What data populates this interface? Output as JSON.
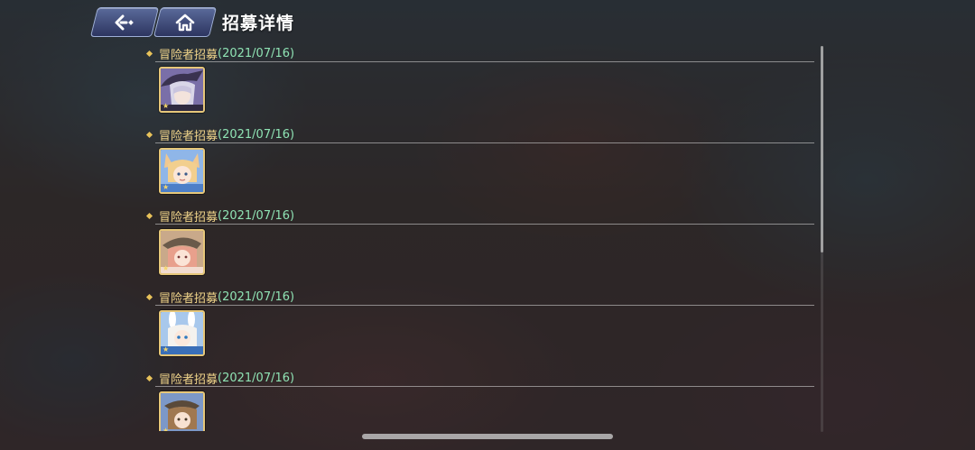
{
  "header": {
    "title": "招募详情",
    "back_icon": "back-arrow-icon",
    "home_icon": "home-icon"
  },
  "colors": {
    "entry_title": "#f0d48a",
    "entry_date": "#8fe3b4",
    "avatar_border": "#e6c77a"
  },
  "entries": [
    {
      "title": "冒险者招募",
      "date": "(2021/07/16)",
      "character": "silver-hair-witch-hat"
    },
    {
      "title": "冒险者招募",
      "date": "(2021/07/16)",
      "character": "blonde-fox-ears"
    },
    {
      "title": "冒险者招募",
      "date": "(2021/07/16)",
      "character": "pink-hair-hat"
    },
    {
      "title": "冒险者招募",
      "date": "(2021/07/16)",
      "character": "white-bunny-ears"
    },
    {
      "title": "冒险者招募",
      "date": "(2021/07/16)",
      "character": "brown-hair-hat"
    }
  ],
  "star_glyph": "★"
}
